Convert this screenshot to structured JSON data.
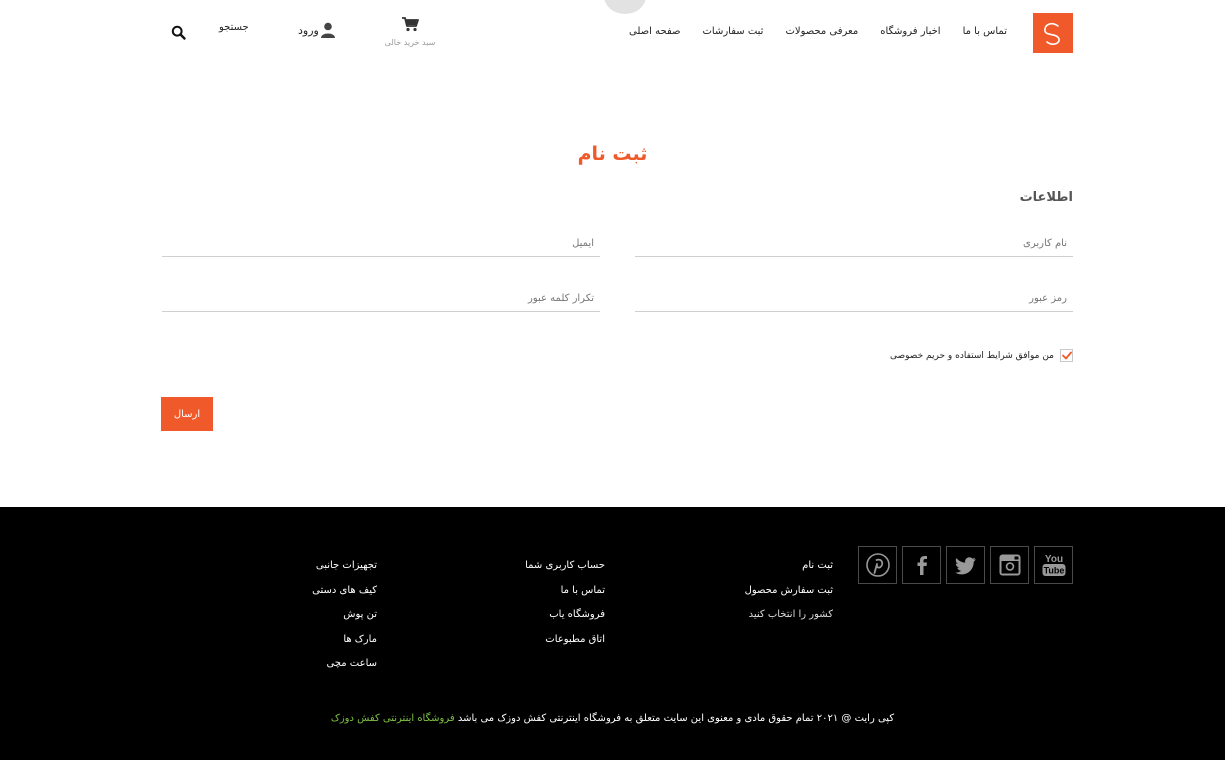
{
  "header": {
    "nav": [
      "صفحه اصلی",
      "ثبت سفارشات",
      "معرفی محصولات",
      "اخبار فروشگاه",
      "تماس با ما"
    ],
    "cart_label": "سبد خرید خالی",
    "login_label": "ورود",
    "search_label": "جستجو"
  },
  "form": {
    "title": "ثبت نام",
    "section_title": "اطلاعات",
    "username_placeholder": "نام کاربری",
    "email_placeholder": "ایمیل",
    "password_placeholder": "رمز عبور",
    "confirm_placeholder": "تکرار کلمه عبور",
    "agree_text": "من موافق شرایط استفاده و حریم خصوصی",
    "agree_checked": true,
    "submit_label": "ارسال"
  },
  "footer": {
    "social": [
      "pinterest-icon",
      "facebook-icon",
      "twitter-icon",
      "instagram-icon",
      "youtube-icon"
    ],
    "col1": [
      "ثبت نام",
      "ثبت سفارش محصول",
      "کشور را انتخاب کنید"
    ],
    "col2": [
      "حساب کاربری شما",
      "تماس با ما",
      "فروشگاه یاب",
      "اتاق مطبوعات"
    ],
    "col3": [
      "تجهیزات جانبی",
      "کیف های دستی",
      "تن پوش",
      "مارک ها",
      "ساعت مچی"
    ],
    "copyright": "کپی رایت @ ۲۰۲۱ تمام حقوق مادی و معنوی این سایت متعلق به فروشگاه اینترنتی کفش دوزک می باشد",
    "copyright_brand": "فروشگاه اینترنتی کفش دوزک"
  },
  "colors": {
    "accent": "#f05a2b",
    "brand_link": "#7ec143",
    "footer_bg": "#000000"
  }
}
